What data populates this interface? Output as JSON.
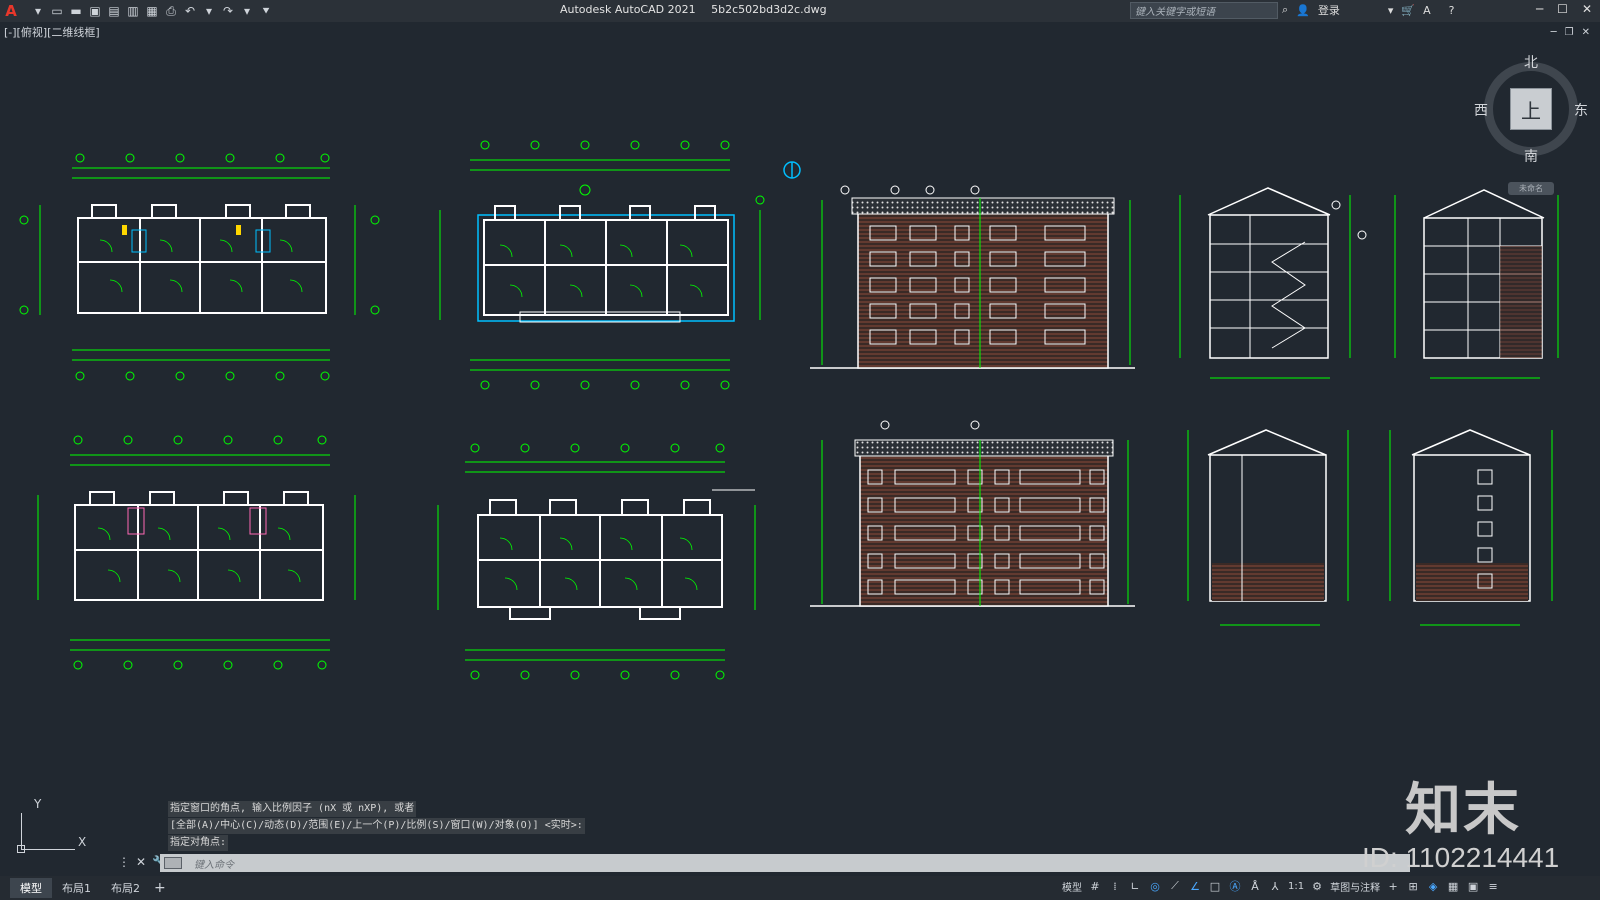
{
  "app": {
    "logo": "A",
    "title": "Autodesk AutoCAD 2021",
    "filename": "5b2c502bd3d2c.dwg",
    "search_placeholder": "键入关键字或短语",
    "login_label": "登录"
  },
  "viewport": {
    "label": "[-][俯视][二维线框]"
  },
  "viewcube": {
    "north": "北",
    "south": "南",
    "west": "西",
    "east": "东",
    "face": "上",
    "wcs": "未命名"
  },
  "ucs": {
    "x": "X",
    "y": "Y"
  },
  "command": {
    "history": [
      "指定窗口的角点, 输入比例因子 (nX 或 nXP), 或者",
      "[全部(A)/中心(C)/动态(D)/范围(E)/上一个(P)/比例(S)/窗口(W)/对象(O)] <实时>:",
      "指定对角点:"
    ],
    "input_placeholder": "键入命令"
  },
  "layout_tabs": [
    {
      "label": "模型",
      "active": true
    },
    {
      "label": "布局1",
      "active": false
    },
    {
      "label": "布局2",
      "active": false
    }
  ],
  "status": {
    "model_label": "模型",
    "scale": "1:1",
    "workspace": "草图与注释"
  },
  "watermark": {
    "brand": "知末",
    "id": "ID: 1102214441"
  },
  "colors": {
    "background": "#212830",
    "drawing_green": "#00ff00",
    "wall_white": "#ffffff",
    "brick_brown": "#8a4a3a",
    "accent_blue": "#4aa8ff"
  }
}
